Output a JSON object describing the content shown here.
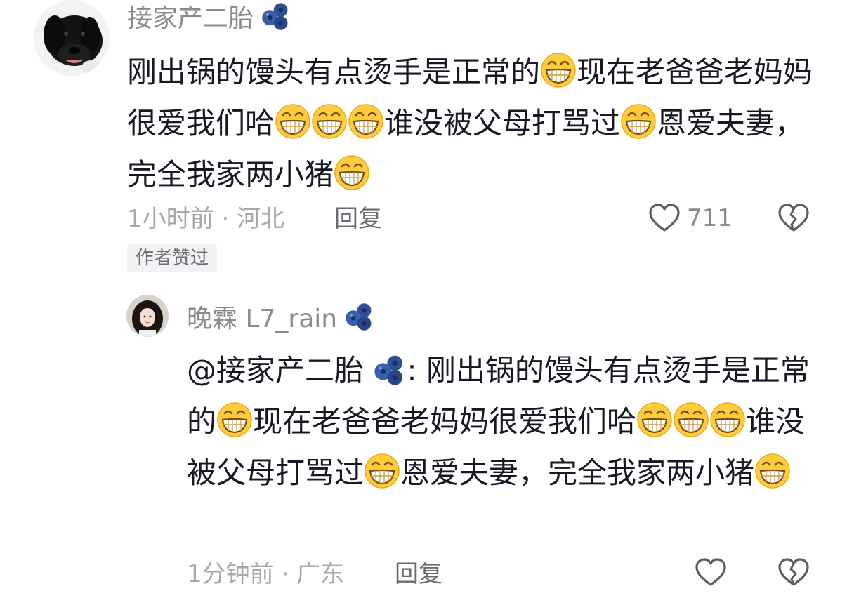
{
  "comments": [
    {
      "username": "接家产二胎",
      "badge_icon": "blueberry-badge-icon",
      "text_parts": [
        "刚出锅的馒头有点烫手是正常的",
        "现在老爸爸老妈妈很爱我们哈",
        "谁没被父母打骂过",
        "恩爱夫妻，完全我家两小猪"
      ],
      "emoji_icon": "grin-emoji-icon",
      "meta": "1小时前 · 河北",
      "reply_label": "回复",
      "like_count": "711",
      "author_tag": "作者赞过"
    },
    {
      "username": "晚霖 L7_rain",
      "badge_icon": "blueberry-badge-icon",
      "mention": "@接家产二胎",
      "mention_sep": ": ",
      "text_parts": [
        "刚出锅的馒头有点烫手是正常的",
        "现在老爸爸老妈妈很爱我们哈",
        "谁没被父母打骂过",
        "恩爱夫妻，完全我家两小猪"
      ],
      "emoji_icon": "grin-emoji-icon",
      "meta": "1分钟前 · 广东",
      "reply_label": "回复"
    }
  ],
  "colors": {
    "primary_text": "#161823",
    "secondary_text": "#8a8b91",
    "meta_text": "#a7a8ad",
    "tag_bg": "#f2f2f4",
    "badge_blue": "#3a5fa8",
    "emoji_yellow": "#ffcd3c"
  }
}
